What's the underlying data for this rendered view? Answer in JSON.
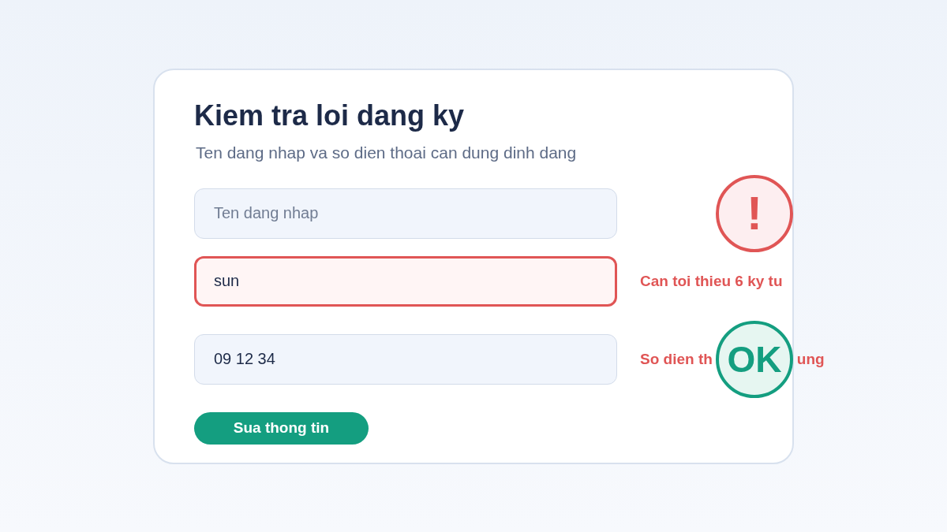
{
  "title": "Kiem tra loi dang ky",
  "subtitle": "Ten dang nhap va so dien thoai can dung dinh dang",
  "fields": [
    {
      "placeholder": "Ten dang nhap",
      "invalid": false,
      "badge": {
        "kind": "alert",
        "symbol": "!"
      }
    },
    {
      "value": "sun",
      "invalid": true,
      "message_parts": [
        "Can toi thieu 6 ky tu"
      ]
    },
    {
      "value": "09 12 34",
      "invalid": false,
      "message_parts": [
        "So dien th",
        "ung"
      ],
      "badge": {
        "kind": "ok",
        "symbol": "OK"
      }
    }
  ],
  "button": "Sua thong tin"
}
